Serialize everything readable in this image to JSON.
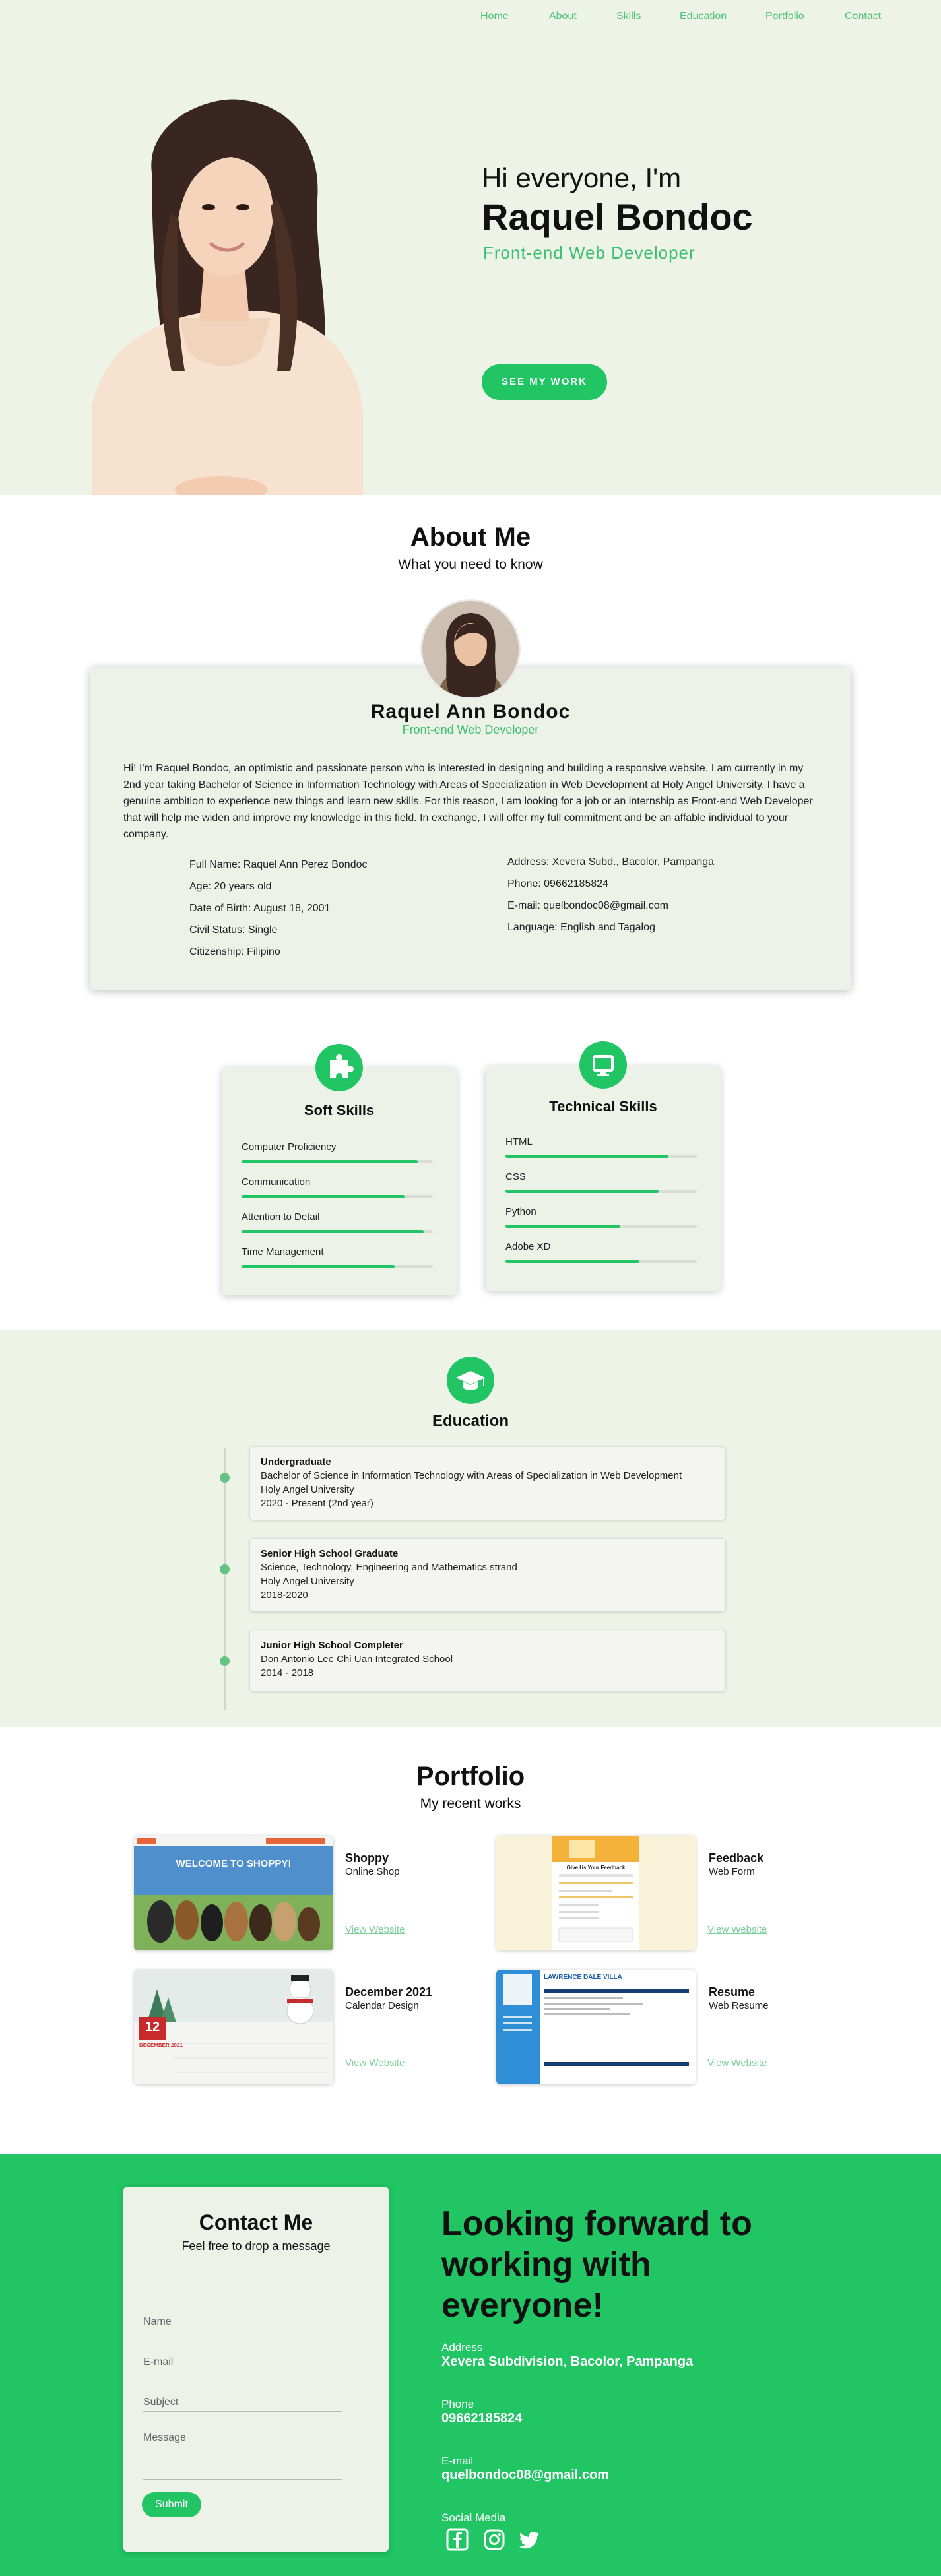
{
  "nav": {
    "items": [
      "Home",
      "About",
      "Skills",
      "Education",
      "Portfolio",
      "Contact"
    ]
  },
  "hero": {
    "greeting": "Hi everyone, I'm",
    "name": "Raquel Bondoc",
    "role": "Front-end Web Developer",
    "cta_label": "SEE MY WORK"
  },
  "about": {
    "title": "About Me",
    "subtitle": "What you need to know",
    "name": "Raquel Ann Bondoc",
    "role": "Front-end Web Developer",
    "bio": "Hi! I'm Raquel Bondoc, an optimistic and passionate person who is interested in designing and building a responsive website. I am currently in my 2nd year taking Bachelor of Science in Information Technology with Areas of Specialization in Web Development at Holy Angel University. I have a genuine ambition to experience new things and learn new skills. For this reason, I am looking for a job or an internship as Front-end Web Developer that will help me widen and improve my knowledge in this field. In exchange, I will offer my full commitment and be an affable individual to your company.",
    "info_left": [
      "Full Name: Raquel Ann Perez Bondoc",
      "Age: 20 years old",
      "Date of Birth: August 18, 2001",
      "Civil Status: Single",
      "Citizenship: Filipino"
    ],
    "info_right": [
      "Address: Xevera Subd., Bacolor, Pampanga",
      "Phone: 09662185824",
      "E-mail: quelbondoc08@gmail.com",
      "Language: English and Tagalog"
    ]
  },
  "skills": {
    "soft": {
      "title": "Soft Skills",
      "items": [
        {
          "label": "Computer Proficiency",
          "level": 0.92
        },
        {
          "label": "Communication",
          "level": 0.85
        },
        {
          "label": "Attention to Detail",
          "level": 0.95
        },
        {
          "label": "Time Management",
          "level": 0.8
        }
      ]
    },
    "technical": {
      "title": "Technical Skills",
      "items": [
        {
          "label": "HTML",
          "level": 0.85
        },
        {
          "label": "CSS",
          "level": 0.8
        },
        {
          "label": "Python",
          "level": 0.6
        },
        {
          "label": "Adobe XD",
          "level": 0.7
        }
      ]
    }
  },
  "education": {
    "title": "Education",
    "entries": [
      {
        "level": "Undergraduate",
        "program": "Bachelor of Science in Information Technology with Areas of Specialization in Web Development",
        "school": "Holy Angel University",
        "years": "2020 - Present (2nd year)"
      },
      {
        "level": "Senior High School Graduate",
        "program": "Science, Technology, Engineering and Mathematics strand",
        "school": "Holy Angel University",
        "years": "2018-2020"
      },
      {
        "level": "Junior High School Completer",
        "program": "Don Antonio Lee Chi Uan Integrated School",
        "school": "2014 - 2018",
        "years": ""
      }
    ]
  },
  "portfolio": {
    "title": "Portfolio",
    "subtitle": "My recent works",
    "link_label": "View Website",
    "items": [
      {
        "title": "Shoppy",
        "subtitle": "Online Shop",
        "thumb_text": "WELCOME TO SHOPPY!"
      },
      {
        "title": "Feedback",
        "subtitle": "Web Form",
        "thumb_text": "Give Us Your Feedback"
      },
      {
        "title": "December 2021",
        "subtitle": "Calendar Design",
        "thumb_text": "DECEMBER 2021",
        "thumb_day": "12"
      },
      {
        "title": "Resume",
        "subtitle": "Web Resume",
        "thumb_text": "LAWRENCE DALE VILLA"
      }
    ]
  },
  "contact": {
    "title": "Contact Me",
    "subtitle": "Feel free to drop a message",
    "fields": {
      "name_placeholder": "Name",
      "email_placeholder": "E-mail",
      "subject_placeholder": "Subject",
      "message_placeholder": "Message"
    },
    "submit_label": "Submit",
    "headline": "Looking forward to working with everyone!",
    "address_label": "Address",
    "address_value": "Xevera Subdivision, Bacolor, Pampanga",
    "phone_label": "Phone",
    "phone_value": "09662185824",
    "email_label": "E-mail",
    "email_value": "quelbondoc08@gmail.com",
    "social_label": "Social Media",
    "social_icons": [
      "facebook-icon",
      "instagram-icon",
      "twitter-icon"
    ]
  },
  "colors": {
    "accent": "#22c564",
    "hero_bg": "#edf4e7",
    "card_bg": "#edf2e8",
    "nav_text": "#4fc07a"
  }
}
